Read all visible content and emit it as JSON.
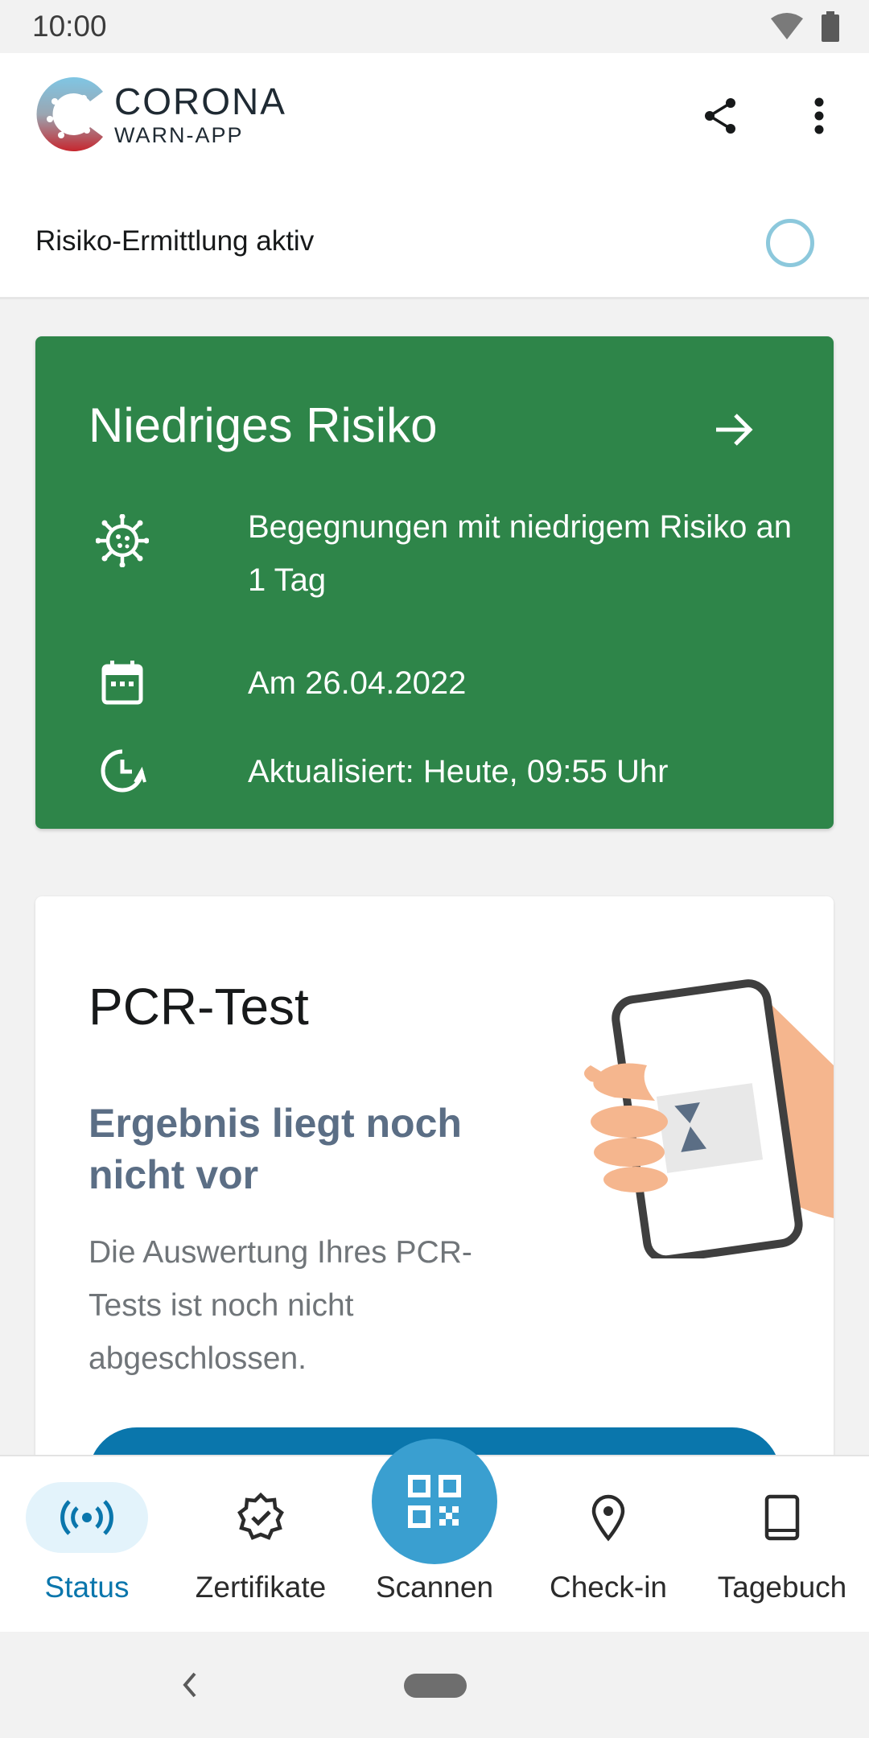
{
  "status_bar": {
    "time": "10:00"
  },
  "app_bar": {
    "logo_line1": "CORONA",
    "logo_line2": "WARN-APP"
  },
  "tracing": {
    "label": "Risiko-Ermittlung aktiv"
  },
  "risk_card": {
    "title": "Niedriges Risiko",
    "encounters": "Begegnungen mit niedrigem Risiko an 1 Tag",
    "date": "Am 26.04.2022",
    "updated": "Aktualisiert: Heute, 09:55 Uhr",
    "color": "#2e8549"
  },
  "test_card": {
    "title": "PCR-Test",
    "subtitle": "Ergebnis liegt noch nicht vor",
    "body": "Die Auswertung Ihres PCR-Tests ist noch nicht abgeschlossen."
  },
  "bottom_nav": {
    "items": [
      {
        "label": "Status",
        "icon": "broadcast-icon",
        "active": true
      },
      {
        "label": "Zertifikate",
        "icon": "certificate-badge-icon",
        "active": false
      },
      {
        "label": "Scannen",
        "icon": "qr-code-icon",
        "active": false
      },
      {
        "label": "Check-in",
        "icon": "location-pin-icon",
        "active": false
      },
      {
        "label": "Tagebuch",
        "icon": "book-icon",
        "active": false
      }
    ],
    "accent": "#0a76ac"
  }
}
